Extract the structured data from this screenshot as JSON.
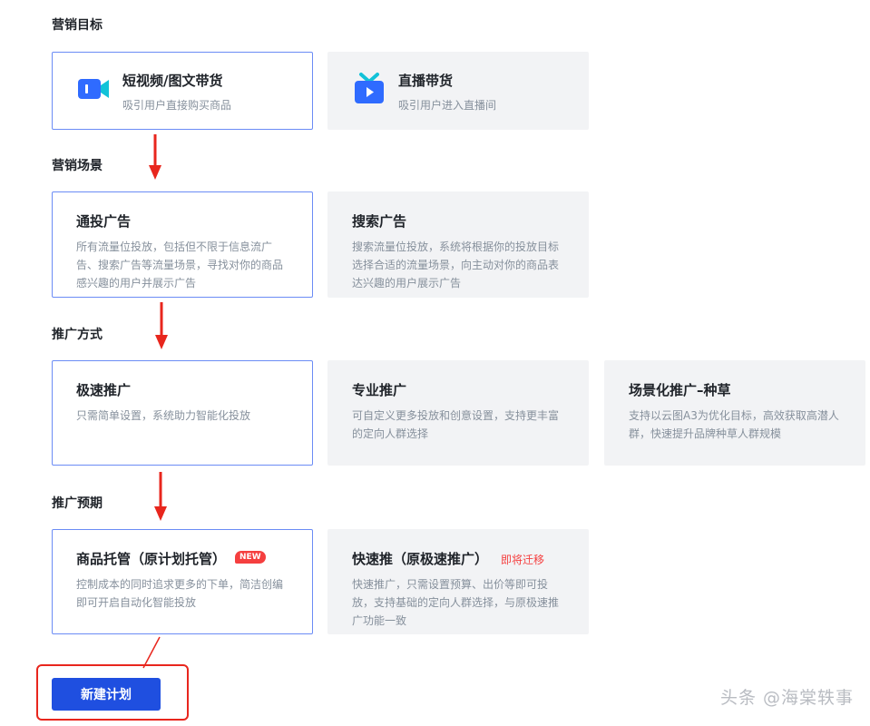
{
  "sections": {
    "goal": "营销目标",
    "scene": "营销场景",
    "method": "推广方式",
    "expectation": "推广预期"
  },
  "goal_cards": [
    {
      "title": "短视频/图文带货",
      "desc": "吸引用户直接购买商品",
      "icon": "video-camera-icon",
      "selected": true
    },
    {
      "title": "直播带货",
      "desc": "吸引用户进入直播间",
      "icon": "live-tv-icon",
      "selected": false
    }
  ],
  "scene_cards": [
    {
      "title": "通投广告",
      "desc": "所有流量位投放，包括但不限于信息流广告、搜索广告等流量场景，寻找对你的商品感兴趣的用户并展示广告",
      "selected": true
    },
    {
      "title": "搜索广告",
      "desc": "搜索流量位投放，系统将根据你的投放目标选择合适的流量场景，向主动对你的商品表达兴趣的用户展示广告",
      "selected": false
    }
  ],
  "method_cards": [
    {
      "title": "极速推广",
      "desc": "只需简单设置，系统助力智能化投放",
      "selected": true
    },
    {
      "title": "专业推广",
      "desc": "可自定义更多投放和创意设置，支持更丰富的定向人群选择",
      "selected": false
    },
    {
      "title": "场景化推广–种草",
      "desc": "支持以云图A3为优化目标，高效获取高潜人群，快速提升品牌种草人群规模",
      "selected": false
    }
  ],
  "expectation_cards": [
    {
      "title": "商品托管（原计划托管）",
      "badge": "NEW",
      "desc": "控制成本的同时追求更多的下单，简洁创编即可开启自动化智能投放",
      "selected": true
    },
    {
      "title": "快速推（原极速推广）",
      "tag": "即将迁移",
      "desc": "快速推广，只需设置预算、出价等即可投放，支持基础的定向人群选择，与原极速推广功能一致",
      "selected": false
    }
  ],
  "primary_button": "新建计划",
  "watermark": "头条 @海棠轶事",
  "colors": {
    "selected_border": "#6b8cf5",
    "card_bg": "#f2f3f5",
    "primary": "#1f4fe0",
    "annotation_red": "#e8261d",
    "tag_red": "#f53f3f"
  }
}
